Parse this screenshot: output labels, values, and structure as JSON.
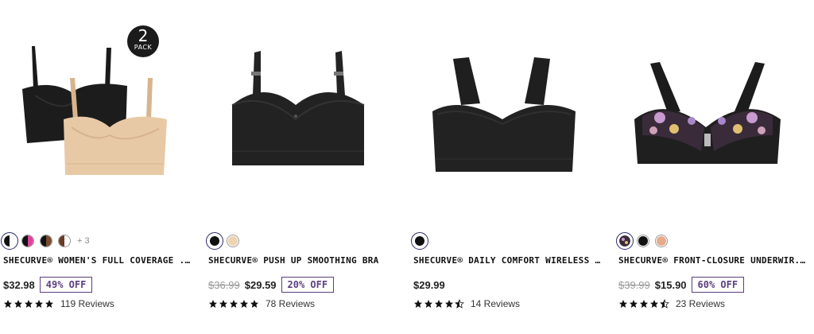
{
  "products": [
    {
      "name": "SHECURVE® WOMEN'S FULL COVERAGE ...",
      "badge": {
        "number": "2",
        "text": "PACK"
      },
      "swatches": [
        {
          "color": "split-black-white",
          "selected": true
        },
        {
          "color": "split-black-pink",
          "selected": false
        },
        {
          "color": "split-black-brown",
          "selected": false
        },
        {
          "color": "split-brown-white",
          "selected": false
        }
      ],
      "more_swatches": "+ 3",
      "old_price": "",
      "price": "$32.98",
      "discount": "49% OFF",
      "rating": 5,
      "reviews": "119 Reviews"
    },
    {
      "name": "SHECURVE® PUSH UP SMOOTHING BRA",
      "swatches": [
        {
          "color": "#111111",
          "selected": true
        },
        {
          "color": "#f0d3b0",
          "selected": false
        }
      ],
      "old_price": "$36.99",
      "price": "$29.59",
      "discount": "20% OFF",
      "rating": 5,
      "reviews": "78 Reviews"
    },
    {
      "name": "SHECURVE® DAILY COMFORT WIRELESS ...",
      "swatches": [
        {
          "color": "#111111",
          "selected": true
        }
      ],
      "old_price": "",
      "price": "$29.99",
      "discount": "",
      "rating": 4.5,
      "reviews": "14 Reviews"
    },
    {
      "name": "SHECURVE® FRONT-CLOSURE UNDERWIR...",
      "swatches": [
        {
          "color": "floral",
          "selected": true
        },
        {
          "color": "#111111",
          "selected": false
        },
        {
          "color": "#e9a98b",
          "selected": false
        }
      ],
      "old_price": "$39.99",
      "price": "$15.90",
      "discount": "60% OFF",
      "rating": 4.5,
      "reviews": "23 Reviews"
    }
  ]
}
